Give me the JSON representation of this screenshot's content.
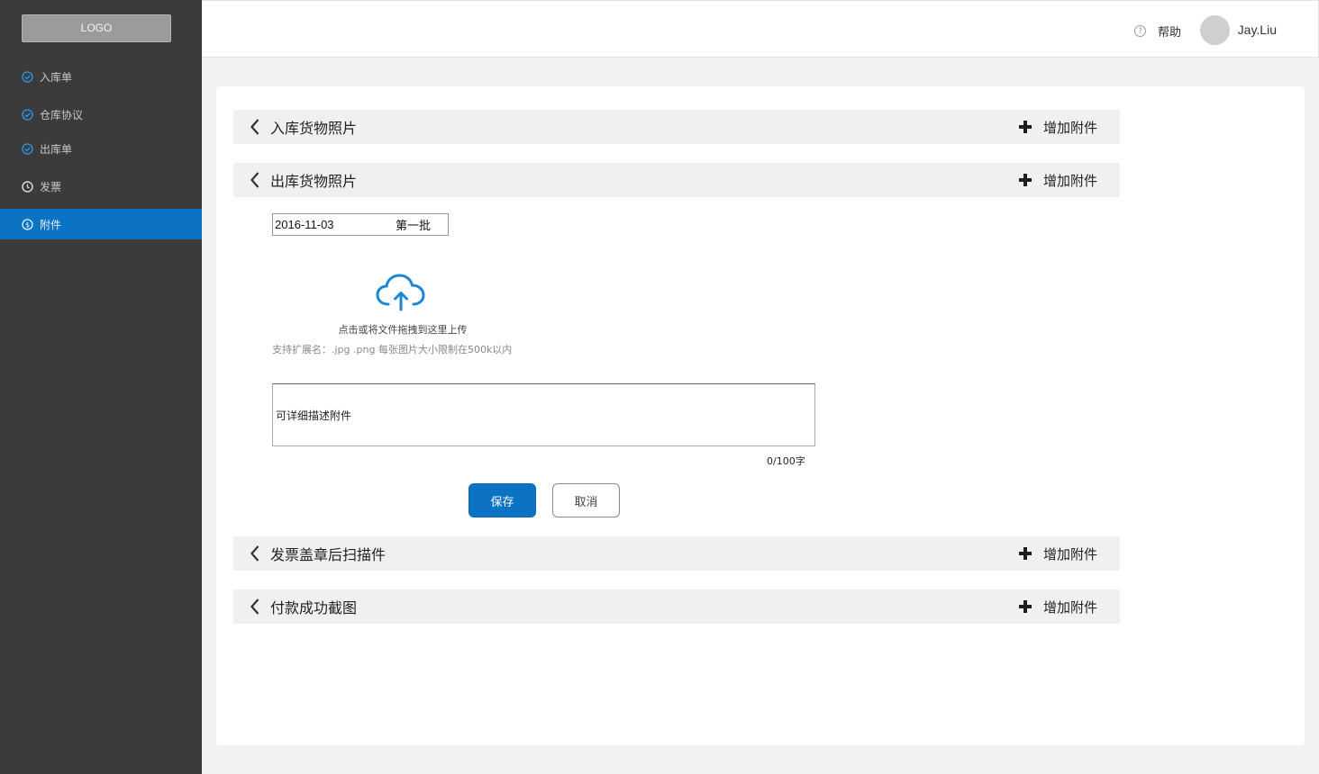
{
  "sidebar": {
    "logo": "LOGO",
    "items": [
      {
        "label": "入库单",
        "icon": "check-circle-icon"
      },
      {
        "label": "仓库协议",
        "icon": "check-circle-icon"
      },
      {
        "label": "出库单",
        "icon": "check-circle-icon"
      },
      {
        "label": "发票",
        "icon": "clock-icon"
      },
      {
        "label": "附件",
        "icon": "dollar-circle-icon",
        "active": true
      }
    ]
  },
  "header": {
    "help_label": "帮助",
    "user_name": "Jay.Liu"
  },
  "sections": [
    {
      "title": "入库货物照片",
      "add_label": "增加附件"
    },
    {
      "title": "出库货物照片",
      "add_label": "增加附件"
    },
    {
      "title": "发票盖章后扫描件",
      "add_label": "增加附件"
    },
    {
      "title": "付款成功截图",
      "add_label": "增加附件"
    }
  ],
  "upload": {
    "date": "2016-11-03",
    "batch": "第一批",
    "hint": "点击或将文件拖拽到这里上传",
    "limit": "支持扩展名：.jpg .png  每张图片大小限制在500k以内",
    "description_placeholder": "可详细描述附件",
    "counter": "0/100字",
    "save_label": "保存",
    "cancel_label": "取消"
  },
  "colors": {
    "sidebar_bg": "#3b3b3b",
    "accent": "#0b72c4",
    "section_bg": "#f0f0f0"
  }
}
